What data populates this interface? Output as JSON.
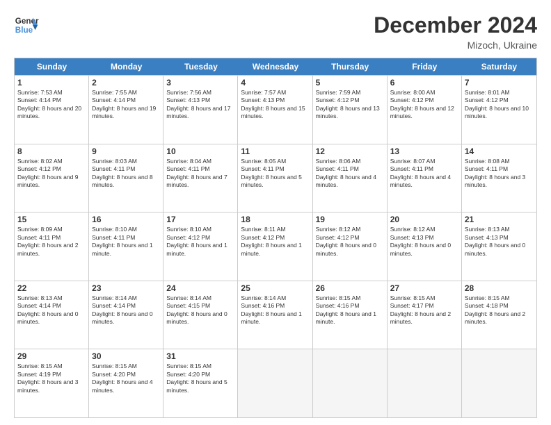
{
  "header": {
    "logo_line1": "General",
    "logo_line2": "Blue",
    "month_title": "December 2024",
    "subtitle": "Mizoch, Ukraine"
  },
  "days_of_week": [
    "Sunday",
    "Monday",
    "Tuesday",
    "Wednesday",
    "Thursday",
    "Friday",
    "Saturday"
  ],
  "weeks": [
    [
      {
        "day": 1,
        "sunrise": "7:53 AM",
        "sunset": "4:14 PM",
        "daylight": "8 hours and 20 minutes."
      },
      {
        "day": 2,
        "sunrise": "7:55 AM",
        "sunset": "4:14 PM",
        "daylight": "8 hours and 19 minutes."
      },
      {
        "day": 3,
        "sunrise": "7:56 AM",
        "sunset": "4:13 PM",
        "daylight": "8 hours and 17 minutes."
      },
      {
        "day": 4,
        "sunrise": "7:57 AM",
        "sunset": "4:13 PM",
        "daylight": "8 hours and 15 minutes."
      },
      {
        "day": 5,
        "sunrise": "7:59 AM",
        "sunset": "4:12 PM",
        "daylight": "8 hours and 13 minutes."
      },
      {
        "day": 6,
        "sunrise": "8:00 AM",
        "sunset": "4:12 PM",
        "daylight": "8 hours and 12 minutes."
      },
      {
        "day": 7,
        "sunrise": "8:01 AM",
        "sunset": "4:12 PM",
        "daylight": "8 hours and 10 minutes."
      }
    ],
    [
      {
        "day": 8,
        "sunrise": "8:02 AM",
        "sunset": "4:12 PM",
        "daylight": "8 hours and 9 minutes."
      },
      {
        "day": 9,
        "sunrise": "8:03 AM",
        "sunset": "4:11 PM",
        "daylight": "8 hours and 8 minutes."
      },
      {
        "day": 10,
        "sunrise": "8:04 AM",
        "sunset": "4:11 PM",
        "daylight": "8 hours and 7 minutes."
      },
      {
        "day": 11,
        "sunrise": "8:05 AM",
        "sunset": "4:11 PM",
        "daylight": "8 hours and 5 minutes."
      },
      {
        "day": 12,
        "sunrise": "8:06 AM",
        "sunset": "4:11 PM",
        "daylight": "8 hours and 4 minutes."
      },
      {
        "day": 13,
        "sunrise": "8:07 AM",
        "sunset": "4:11 PM",
        "daylight": "8 hours and 4 minutes."
      },
      {
        "day": 14,
        "sunrise": "8:08 AM",
        "sunset": "4:11 PM",
        "daylight": "8 hours and 3 minutes."
      }
    ],
    [
      {
        "day": 15,
        "sunrise": "8:09 AM",
        "sunset": "4:11 PM",
        "daylight": "8 hours and 2 minutes."
      },
      {
        "day": 16,
        "sunrise": "8:10 AM",
        "sunset": "4:11 PM",
        "daylight": "8 hours and 1 minute."
      },
      {
        "day": 17,
        "sunrise": "8:10 AM",
        "sunset": "4:12 PM",
        "daylight": "8 hours and 1 minute."
      },
      {
        "day": 18,
        "sunrise": "8:11 AM",
        "sunset": "4:12 PM",
        "daylight": "8 hours and 1 minute."
      },
      {
        "day": 19,
        "sunrise": "8:12 AM",
        "sunset": "4:12 PM",
        "daylight": "8 hours and 0 minutes."
      },
      {
        "day": 20,
        "sunrise": "8:12 AM",
        "sunset": "4:13 PM",
        "daylight": "8 hours and 0 minutes."
      },
      {
        "day": 21,
        "sunrise": "8:13 AM",
        "sunset": "4:13 PM",
        "daylight": "8 hours and 0 minutes."
      }
    ],
    [
      {
        "day": 22,
        "sunrise": "8:13 AM",
        "sunset": "4:14 PM",
        "daylight": "8 hours and 0 minutes."
      },
      {
        "day": 23,
        "sunrise": "8:14 AM",
        "sunset": "4:14 PM",
        "daylight": "8 hours and 0 minutes."
      },
      {
        "day": 24,
        "sunrise": "8:14 AM",
        "sunset": "4:15 PM",
        "daylight": "8 hours and 0 minutes."
      },
      {
        "day": 25,
        "sunrise": "8:14 AM",
        "sunset": "4:16 PM",
        "daylight": "8 hours and 1 minute."
      },
      {
        "day": 26,
        "sunrise": "8:15 AM",
        "sunset": "4:16 PM",
        "daylight": "8 hours and 1 minute."
      },
      {
        "day": 27,
        "sunrise": "8:15 AM",
        "sunset": "4:17 PM",
        "daylight": "8 hours and 2 minutes."
      },
      {
        "day": 28,
        "sunrise": "8:15 AM",
        "sunset": "4:18 PM",
        "daylight": "8 hours and 2 minutes."
      }
    ],
    [
      {
        "day": 29,
        "sunrise": "8:15 AM",
        "sunset": "4:19 PM",
        "daylight": "8 hours and 3 minutes."
      },
      {
        "day": 30,
        "sunrise": "8:15 AM",
        "sunset": "4:20 PM",
        "daylight": "8 hours and 4 minutes."
      },
      {
        "day": 31,
        "sunrise": "8:15 AM",
        "sunset": "4:20 PM",
        "daylight": "8 hours and 5 minutes."
      },
      null,
      null,
      null,
      null
    ]
  ]
}
